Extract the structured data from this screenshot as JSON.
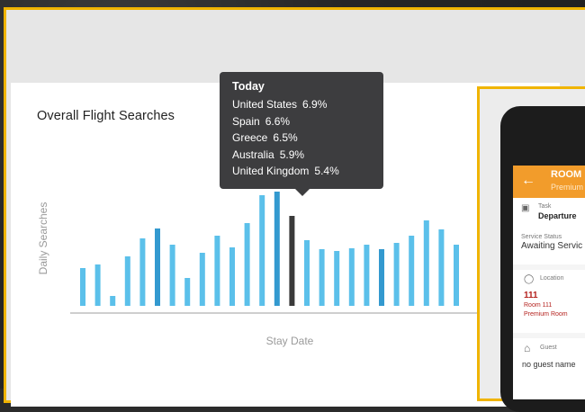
{
  "page": {
    "title": "Overall Flight Searches"
  },
  "chart_data": {
    "type": "bar",
    "title": "Overall Flight Searches",
    "xlabel": "Stay Date",
    "ylabel": "Daily Searches",
    "grid": false,
    "values": [
      42,
      46,
      11,
      55,
      75,
      86,
      68,
      31,
      59,
      78,
      65,
      92,
      123,
      127,
      100,
      73,
      63,
      61,
      64,
      68,
      63,
      70,
      78,
      95,
      85,
      68
    ],
    "ylim": [
      0,
      135
    ],
    "colors": {
      "normal": "#5bc0ea",
      "emphasis": "#3399cf",
      "selected": "#3a3a3a",
      "axis": "#bdbdbd"
    },
    "emphasis_index": [
      5,
      13,
      20
    ],
    "selected_index": 14
  },
  "tooltip": {
    "title": "Today",
    "rows": [
      {
        "country": "United States",
        "pct": "6.9%"
      },
      {
        "country": "Spain",
        "pct": "6.6%"
      },
      {
        "country": "Greece",
        "pct": "6.5%"
      },
      {
        "country": "Australia",
        "pct": "5.9%"
      },
      {
        "country": "United Kingdom",
        "pct": "5.4%"
      }
    ]
  },
  "phone_app": {
    "back_icon": "arrow-left-icon",
    "header_title": "ROOM",
    "header_subtitle": "Premium",
    "task_label": "Task",
    "task_value": "Departure",
    "service_status_label": "Service Status",
    "service_status_value": "Awaiting Servic",
    "location_label": "Location",
    "room_number": "111",
    "room_name": "Room 111",
    "room_type": "Premium Room",
    "guest_label": "Guest",
    "guest_value": "no guest name"
  }
}
